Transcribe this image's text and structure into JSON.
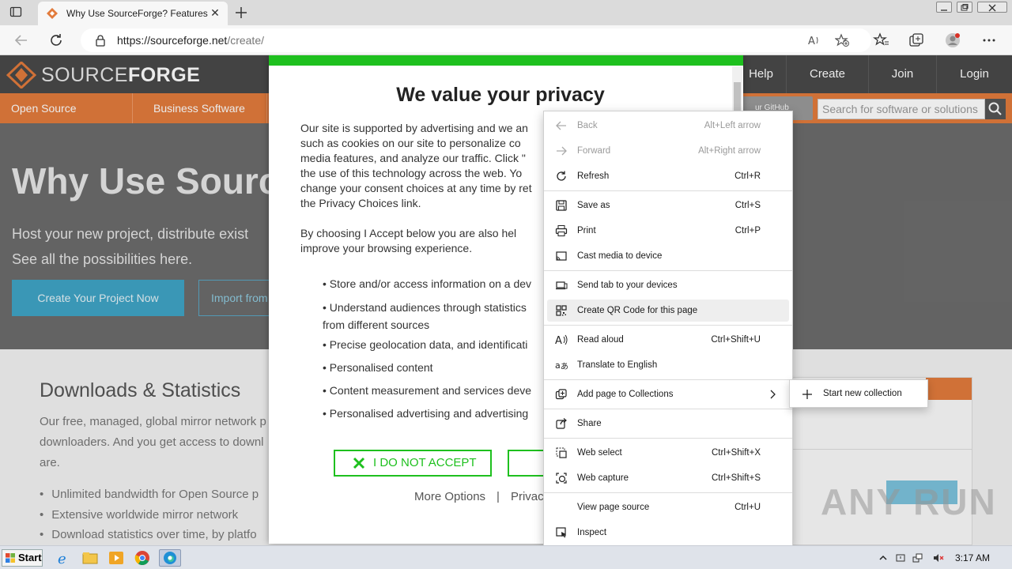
{
  "browser": {
    "tab_title": "Why Use SourceForge? Features a",
    "url_host": "https://sourceforge.net",
    "url_path": "/create/"
  },
  "site": {
    "logo_text_light": "SOURCE",
    "logo_text_bold": "FORGE",
    "nav": [
      "Help",
      "Create",
      "Join",
      "Login"
    ],
    "subnav": [
      "Open Source Software",
      "Business Software"
    ],
    "github_button": "ur GitHub Project",
    "search_placeholder": "Search for software or solutions",
    "hero_title": "Why Use Source",
    "hero_line1": "Host your new project, distribute exist",
    "hero_line2": "See all the possibilities here.",
    "hero_cta": "Create Your Project Now",
    "hero_import": "Import from",
    "downloads_title": "Downloads & Statistics",
    "downloads_line1": "Our free, managed, global mirror network p",
    "downloads_line2": "downloaders. And you get access to downl",
    "downloads_line3": "are.",
    "downloads_list": [
      "Unlimited bandwidth for Open Source p",
      "Extensive worldwide mirror network",
      "Download statistics over time, by platfo"
    ]
  },
  "privacy_modal": {
    "title": "We value your privacy",
    "para1": [
      "Our site is supported by advertising and we an",
      "such as cookies on our site to personalize co",
      "media features, and analyze our traffic. Click \"",
      "the use of this technology across the web. Yo",
      "change your consent choices at any time by ret",
      "the Privacy Choices link."
    ],
    "para2": [
      "By choosing I Accept below you are also hel",
      "improve your browsing experience."
    ],
    "list": [
      "Store and/or access information on a dev",
      "Understand audiences through statistics",
      "from different sources",
      "Precise geolocation data, and identificati",
      "Personalised content",
      "Content measurement and services deve",
      "Personalised advertising and advertising"
    ],
    "reject_label": "I DO NOT ACCEPT",
    "more_options": "More Options",
    "separator": "|",
    "privacy_link": "Privac"
  },
  "context_menu": {
    "items": [
      {
        "label": "Back",
        "shortcut": "Alt+Left arrow"
      },
      {
        "label": "Forward",
        "shortcut": "Alt+Right arrow"
      },
      {
        "label": "Refresh",
        "shortcut": "Ctrl+R"
      },
      {
        "label": "Save as",
        "shortcut": "Ctrl+S"
      },
      {
        "label": "Print",
        "shortcut": "Ctrl+P"
      },
      {
        "label": "Cast media to device",
        "shortcut": ""
      },
      {
        "label": "Send tab to your devices",
        "shortcut": ""
      },
      {
        "label": "Create QR Code for this page",
        "shortcut": ""
      },
      {
        "label": "Read aloud",
        "shortcut": "Ctrl+Shift+U"
      },
      {
        "label": "Translate to English",
        "shortcut": ""
      },
      {
        "label": "Add page to Collections",
        "shortcut": ""
      },
      {
        "label": "Share",
        "shortcut": ""
      },
      {
        "label": "Web select",
        "shortcut": "Ctrl+Shift+X"
      },
      {
        "label": "Web capture",
        "shortcut": "Ctrl+Shift+S"
      },
      {
        "label": "View page source",
        "shortcut": "Ctrl+U"
      },
      {
        "label": "Inspect",
        "shortcut": ""
      }
    ],
    "submenu_item": "Start new collection"
  },
  "watermark": "ANY RUN",
  "taskbar": {
    "start_label": "Start",
    "clock": "3:17 AM"
  },
  "colors": {
    "sf_orange": "#e27b3c",
    "sf_dark": "#494949",
    "modal_green": "#1ec01e",
    "cta_blue": "#3fa4c6"
  }
}
